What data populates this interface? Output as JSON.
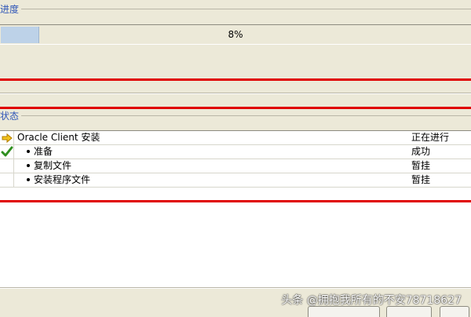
{
  "progress": {
    "section_title": "进度",
    "percent_label": "8%",
    "fraction": 0.08
  },
  "status": {
    "section_title": "状态",
    "rows": [
      {
        "icon": "arrow-right-icon",
        "label": "Oracle Client 安装",
        "status": "正在进行",
        "bullet": false
      },
      {
        "icon": "checkmark-icon",
        "label": "准备",
        "status": "成功",
        "bullet": true
      },
      {
        "icon": "",
        "label": "复制文件",
        "status": "暂挂",
        "bullet": true
      },
      {
        "icon": "",
        "label": "安装程序文件",
        "status": "暂挂",
        "bullet": true
      }
    ]
  },
  "watermark": "头条 @拥抱我所有的不安78718627",
  "colors": {
    "section_title": "#2f56b8",
    "progress_fill": "#bdd2e8",
    "annotation_red": "#e00000",
    "background": "#ece9d8"
  }
}
